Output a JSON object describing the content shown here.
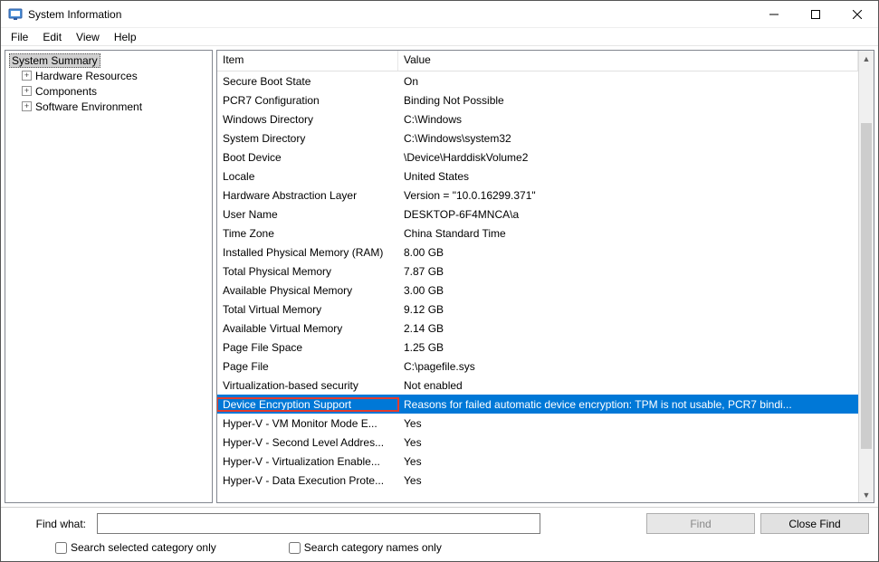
{
  "window": {
    "title": "System Information"
  },
  "menu": {
    "file": "File",
    "edit": "Edit",
    "view": "View",
    "help": "Help"
  },
  "tree": {
    "root": "System Summary",
    "children": [
      {
        "label": "Hardware Resources"
      },
      {
        "label": "Components"
      },
      {
        "label": "Software Environment"
      }
    ]
  },
  "list": {
    "headers": {
      "item": "Item",
      "value": "Value"
    },
    "rows": [
      {
        "item": "Secure Boot State",
        "value": "On"
      },
      {
        "item": "PCR7 Configuration",
        "value": "Binding Not Possible"
      },
      {
        "item": "Windows Directory",
        "value": "C:\\Windows"
      },
      {
        "item": "System Directory",
        "value": "C:\\Windows\\system32"
      },
      {
        "item": "Boot Device",
        "value": "\\Device\\HarddiskVolume2"
      },
      {
        "item": "Locale",
        "value": "United States"
      },
      {
        "item": "Hardware Abstraction Layer",
        "value": "Version = \"10.0.16299.371\""
      },
      {
        "item": "User Name",
        "value": "DESKTOP-6F4MNCA\\a"
      },
      {
        "item": "Time Zone",
        "value": "China Standard Time"
      },
      {
        "item": "Installed Physical Memory (RAM)",
        "value": "8.00 GB"
      },
      {
        "item": "Total Physical Memory",
        "value": "7.87 GB"
      },
      {
        "item": "Available Physical Memory",
        "value": "3.00 GB"
      },
      {
        "item": "Total Virtual Memory",
        "value": "9.12 GB"
      },
      {
        "item": "Available Virtual Memory",
        "value": "2.14 GB"
      },
      {
        "item": "Page File Space",
        "value": "1.25 GB"
      },
      {
        "item": "Page File",
        "value": "C:\\pagefile.sys"
      },
      {
        "item": "Virtualization-based security",
        "value": "Not enabled"
      },
      {
        "item": "Device Encryption Support",
        "value": "Reasons for failed automatic device encryption: TPM is not usable, PCR7 bindi...",
        "selected": true,
        "highlight": true
      },
      {
        "item": "Hyper-V - VM Monitor Mode E...",
        "value": "Yes"
      },
      {
        "item": "Hyper-V - Second Level Addres...",
        "value": "Yes"
      },
      {
        "item": "Hyper-V - Virtualization Enable...",
        "value": "Yes"
      },
      {
        "item": "Hyper-V - Data Execution Prote...",
        "value": "Yes"
      }
    ]
  },
  "find": {
    "label": "Find what:",
    "value": "",
    "find_btn": "Find",
    "close_btn": "Close Find",
    "chk_selected": "Search selected category only",
    "chk_names": "Search category names only"
  }
}
